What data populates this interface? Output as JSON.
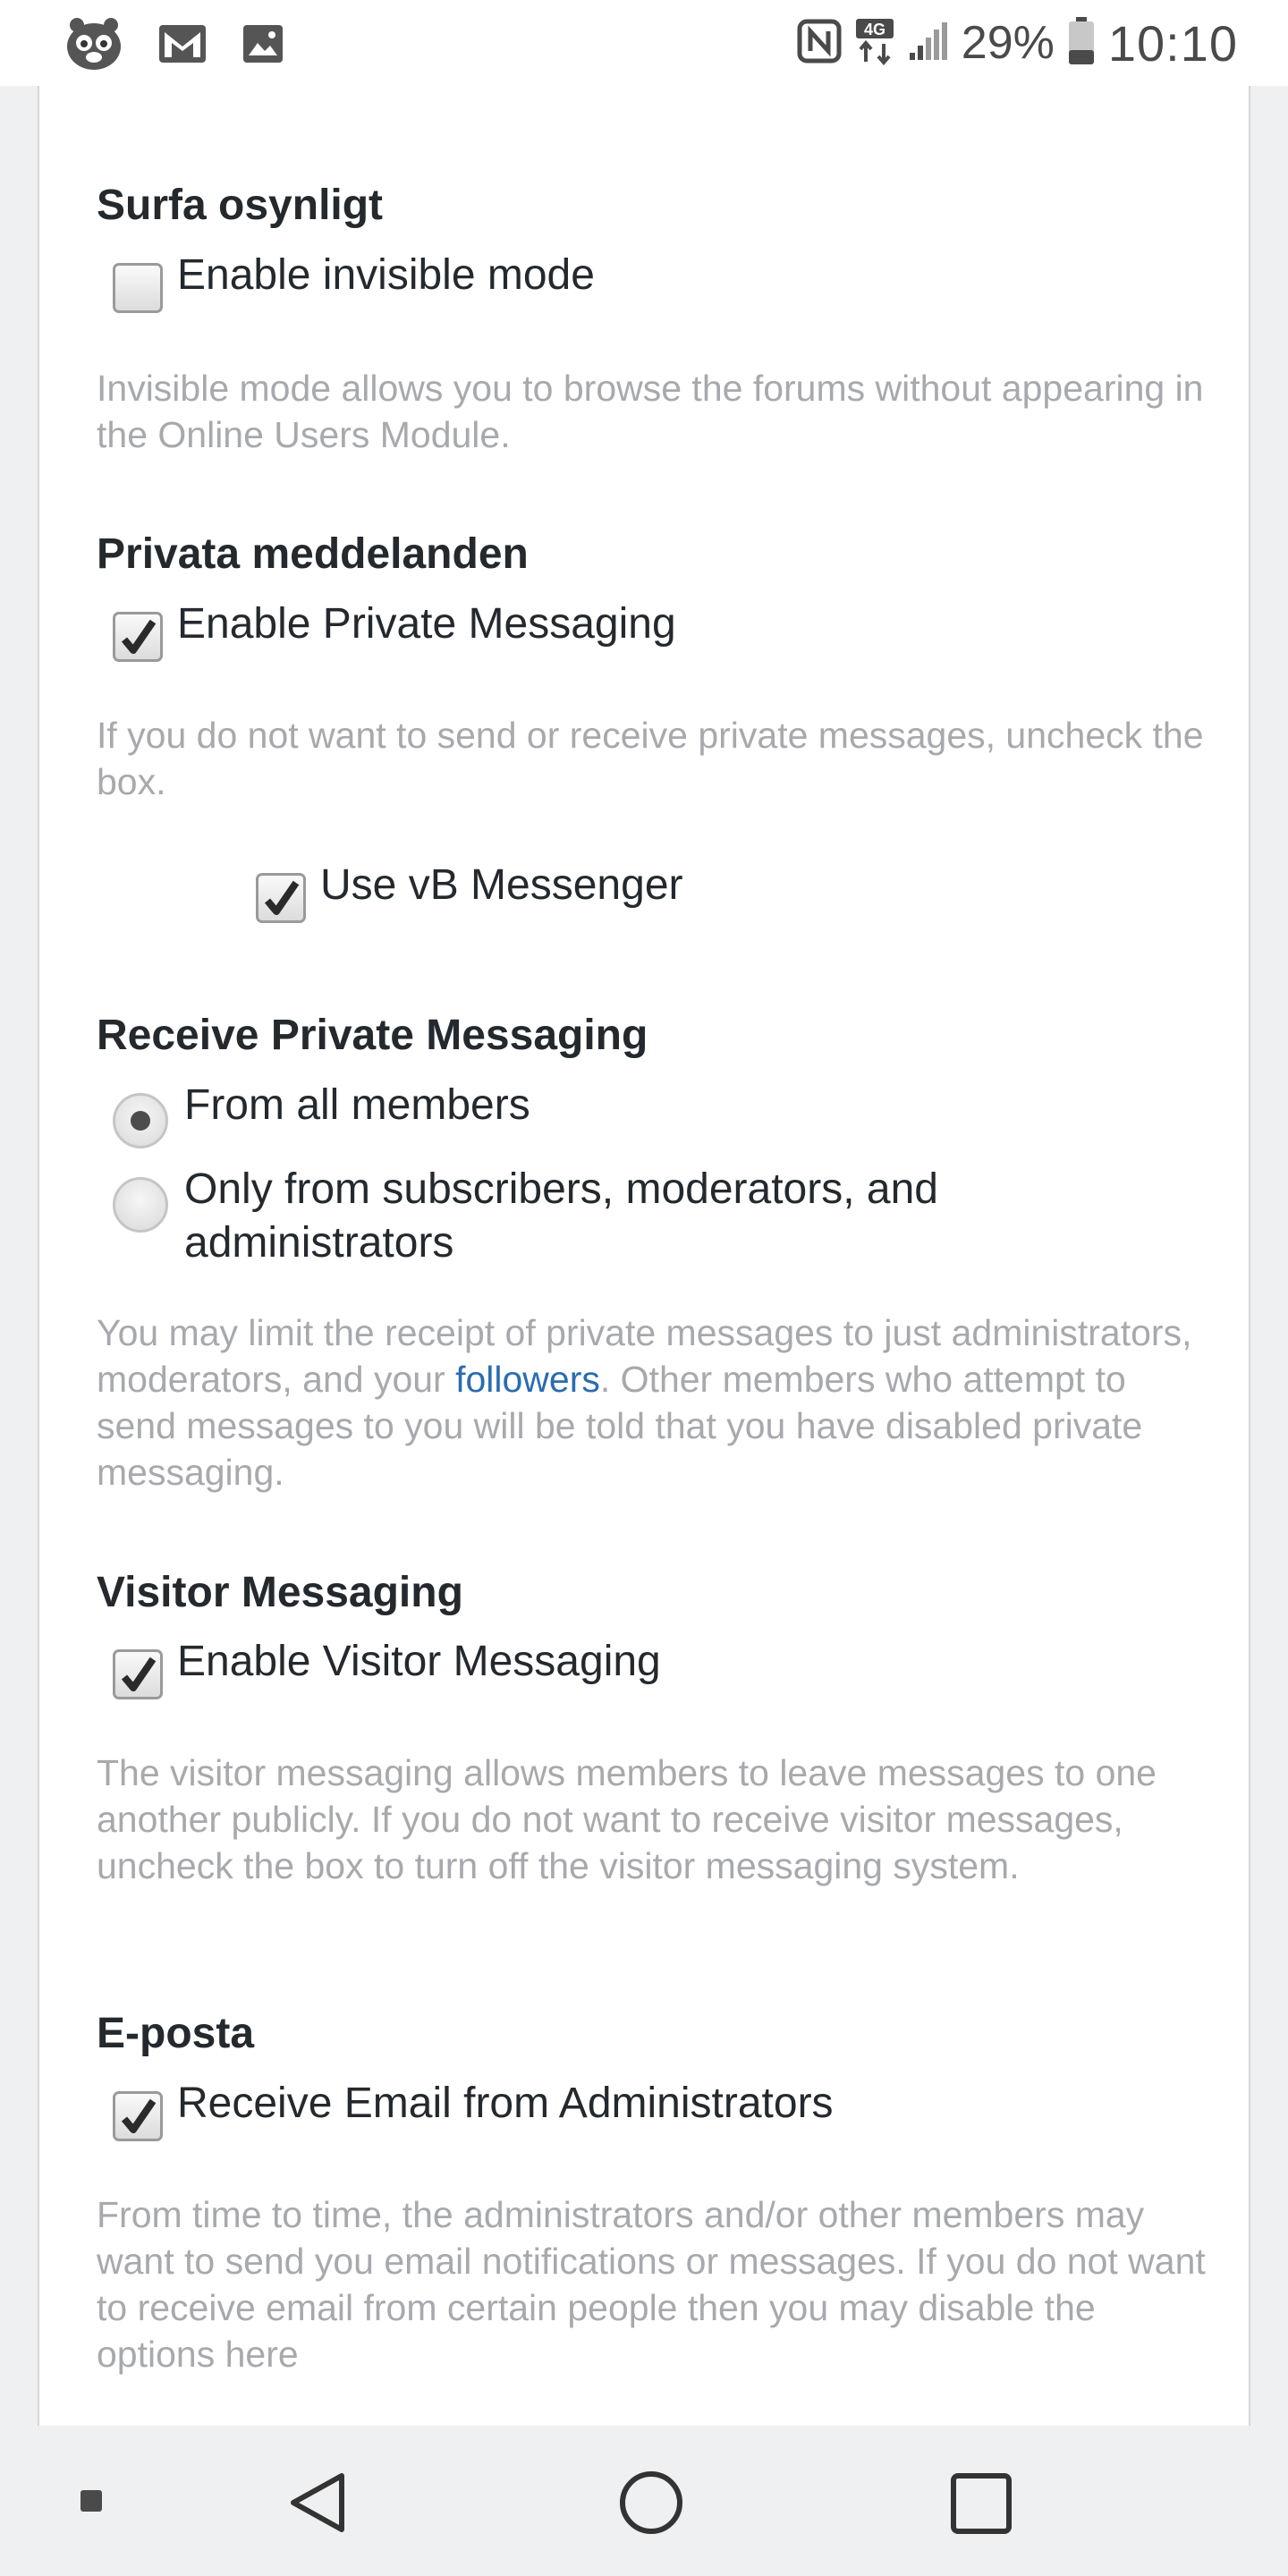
{
  "status_bar": {
    "left_icons": [
      "hoot-app-icon",
      "gmail-icon",
      "gallery-icon"
    ],
    "right_icons": [
      "nfc-icon",
      "4g-data-icon",
      "signal-icon",
      "battery-icon"
    ],
    "network": "4G",
    "battery_percent": "29%",
    "time": "10:10"
  },
  "sections": {
    "invisible": {
      "title": "Surfa osynligt",
      "option_label": "Enable invisible mode",
      "checked": false,
      "description": "Invisible mode allows you to browse the forums without appearing in the Online Users Module."
    },
    "private_messages": {
      "title": "Privata meddelanden",
      "option_label": "Enable Private Messaging",
      "checked": true,
      "description": "If you do not want to send or receive private messages, uncheck the box.",
      "messenger_label": "Use vB Messenger",
      "messenger_checked": true
    },
    "receive_pm": {
      "title": "Receive Private Messaging",
      "radio_all": "From all members",
      "radio_limited_line1": "Only from subscribers, moderators, and",
      "radio_limited_line2": "administrators",
      "selected": "From all members",
      "description_before": "You may limit the receipt of private messages to just administrators, moderators, and your ",
      "description_link": "followers",
      "description_after": ". Other members who attempt to send messages to you will be told that you have disabled private messaging."
    },
    "visitor": {
      "title": "Visitor Messaging",
      "option_label": "Enable Visitor Messaging",
      "checked": true,
      "description": "The visitor messaging allows members to leave messages to one another publicly. If you do not want to receive visitor messages, uncheck the box to turn off the visitor messaging system."
    },
    "email": {
      "title": "E-posta",
      "option_label": "Receive Email from Administrators",
      "checked": true,
      "description": "From time to time, the administrators and/or other members may want to send you email notifications or messages. If you do not want to receive email from certain people then you may disable the options here"
    }
  },
  "nav_bar": {
    "buttons": [
      "menu-dot-icon",
      "back-icon",
      "home-icon",
      "recents-icon"
    ]
  },
  "colors": {
    "title_text": "#24292e",
    "description_text": "#a7a9ac",
    "link": "#2b6cb0",
    "page_margin": "#eff0f1"
  }
}
